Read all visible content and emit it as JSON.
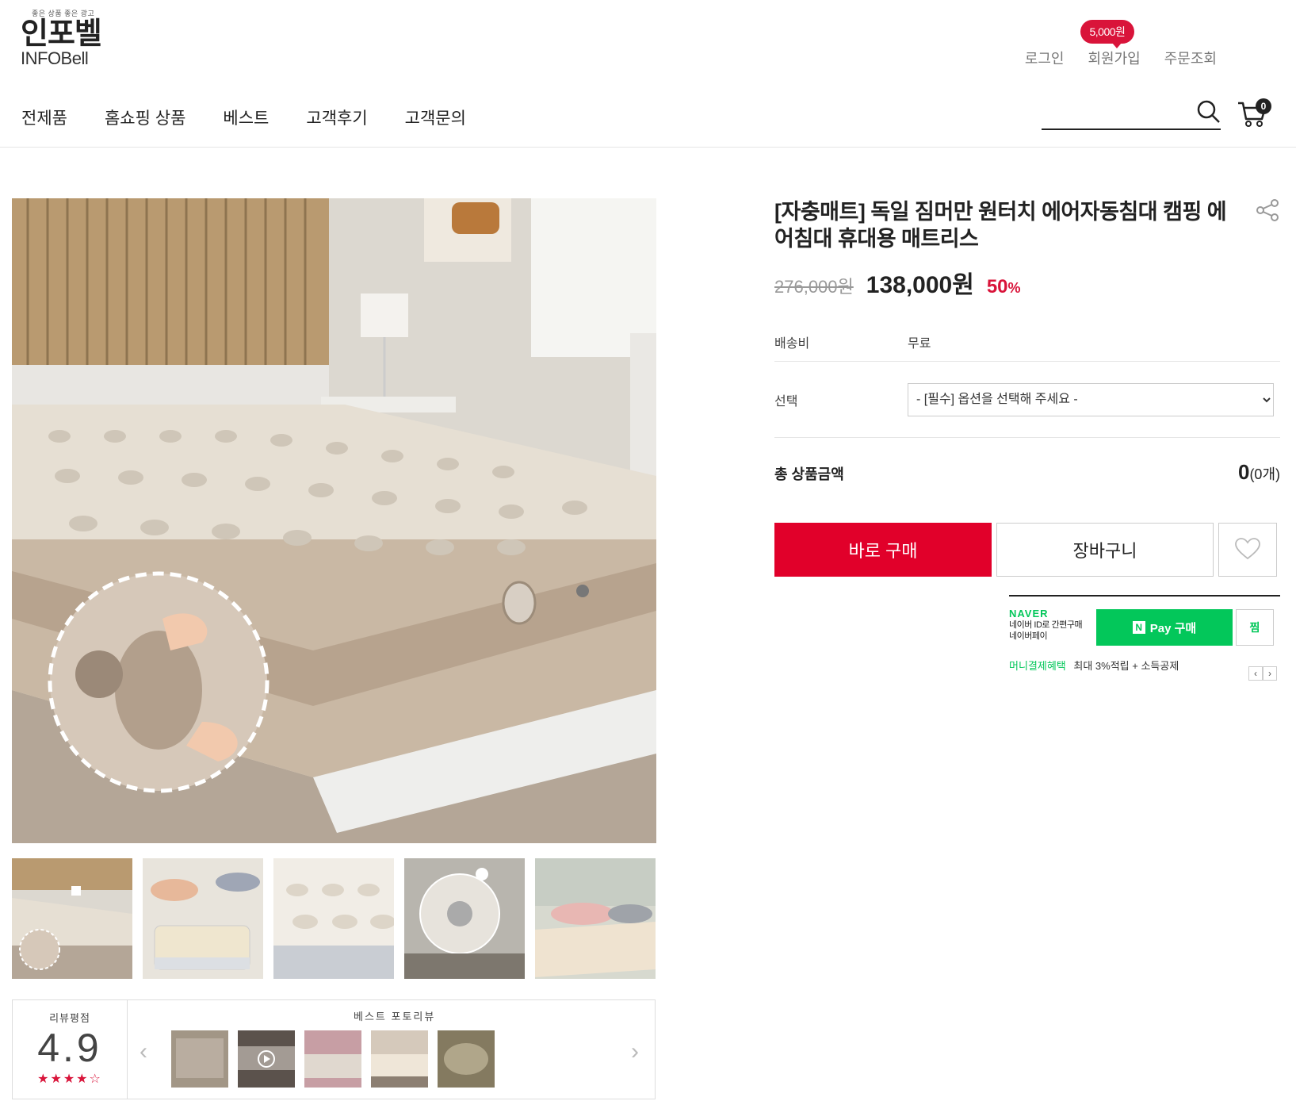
{
  "header": {
    "logo": {
      "tagline": "좋은 상품 좋은 광고",
      "kor": "인포벨",
      "eng": "INFOBell"
    },
    "util": {
      "login": "로그인",
      "join": "회원가입",
      "join_badge": "5,000원",
      "orders": "주문조회"
    },
    "nav": [
      "전제품",
      "홈쇼핑 상품",
      "베스트",
      "고객후기",
      "고객문의"
    ],
    "search": {
      "value": "",
      "placeholder": ""
    },
    "cart_count": "0"
  },
  "product": {
    "title": "[자충매트] 독일 짐머만 원터치 에어자동침대 캠핑 에어침대 휴대용 매트리스",
    "original_price": "276,000원",
    "sale_price": "138,000원",
    "discount": "50",
    "discount_unit": "%",
    "shipping_label": "배송비",
    "shipping_value": "무료",
    "option_label": "선택",
    "option_selected": "- [필수] 옵션을 선택해 주세요 -",
    "total_label": "총 상품금액",
    "total_value": "0",
    "total_count": "(0개)",
    "buy_now": "바로 구매",
    "add_cart": "장바구니"
  },
  "naver_pay": {
    "brand": "NAVER",
    "sub1": "네이버 ID로 간편구매",
    "sub2": "네이버페이",
    "pay_n": "N",
    "pay_label": "Pay 구매",
    "jjim": "찜",
    "benefit_label": "머니결제혜택",
    "benefit_text": "최대 3%적립 + 소득공제",
    "prev": "‹",
    "next": "›"
  },
  "reviews": {
    "rating_label": "리뷰평점",
    "score": "4.9",
    "stars": "★★★★☆",
    "rating_value": 4.9,
    "photo_label": "베스트 포토리뷰",
    "prev": "‹",
    "next": "›"
  },
  "thumbs": [
    "mattress-room",
    "people-on-bed",
    "mattress-closeup",
    "valve-diagram",
    "couple-lounging"
  ],
  "review_thumbs": [
    "box-package",
    "video-review",
    "pink-room",
    "mattress-bed",
    "camo-bag"
  ],
  "colors": {
    "accent": "#e1002a",
    "naver": "#03c75a"
  }
}
